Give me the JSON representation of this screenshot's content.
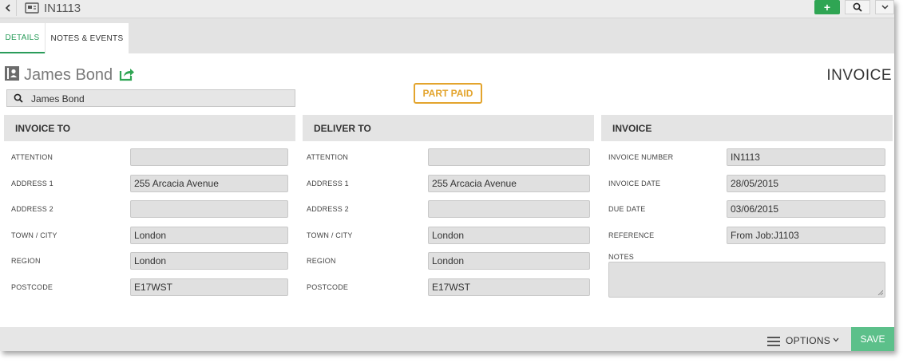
{
  "titlebar": {
    "title": "IN1113",
    "add_label": "+"
  },
  "tabs": [
    {
      "label": "DETAILS",
      "active": true
    },
    {
      "label": "NOTES & EVENTS",
      "active": false
    }
  ],
  "header": {
    "contact_name": "James Bond",
    "status_badge": "PART PAID",
    "document_type": "INVOICE",
    "contact_search_value": "James Bond"
  },
  "invoice_to": {
    "heading": "INVOICE TO",
    "fields": [
      {
        "label": "ATTENTION",
        "value": ""
      },
      {
        "label": "ADDRESS 1",
        "value": "255 Arcacia Avenue"
      },
      {
        "label": "ADDRESS 2",
        "value": ""
      },
      {
        "label": "TOWN / CITY",
        "value": "London"
      },
      {
        "label": "REGION",
        "value": "London"
      },
      {
        "label": "POSTCODE",
        "value": "E17WST"
      }
    ]
  },
  "deliver_to": {
    "heading": "DELIVER TO",
    "fields": [
      {
        "label": "ATTENTION",
        "value": ""
      },
      {
        "label": "ADDRESS 1",
        "value": "255 Arcacia Avenue"
      },
      {
        "label": "ADDRESS 2",
        "value": ""
      },
      {
        "label": "TOWN / CITY",
        "value": "London"
      },
      {
        "label": "REGION",
        "value": "London"
      },
      {
        "label": "POSTCODE",
        "value": "E17WST"
      }
    ]
  },
  "invoice": {
    "heading": "INVOICE",
    "fields": [
      {
        "label": "INVOICE NUMBER",
        "value": "IN1113"
      },
      {
        "label": "INVOICE DATE",
        "value": "28/05/2015"
      },
      {
        "label": "DUE DATE",
        "value": "03/06/2015"
      },
      {
        "label": "REFERENCE",
        "value": "From Job:J1103"
      }
    ],
    "notes_label": "NOTES",
    "notes_value": ""
  },
  "footer": {
    "options_label": "OPTIONS",
    "save_label": "SAVE"
  },
  "colors": {
    "accent_green": "#2fa553",
    "save_green": "#5cc08a",
    "status_orange": "#e3a42d",
    "tab_active_text": "#2a9c5a"
  },
  "icons": [
    "back-arrow-icon",
    "document-icon",
    "plus-icon",
    "search-icon",
    "chevron-down-icon",
    "contact-card-icon",
    "share-icon",
    "hamburger-icon"
  ]
}
